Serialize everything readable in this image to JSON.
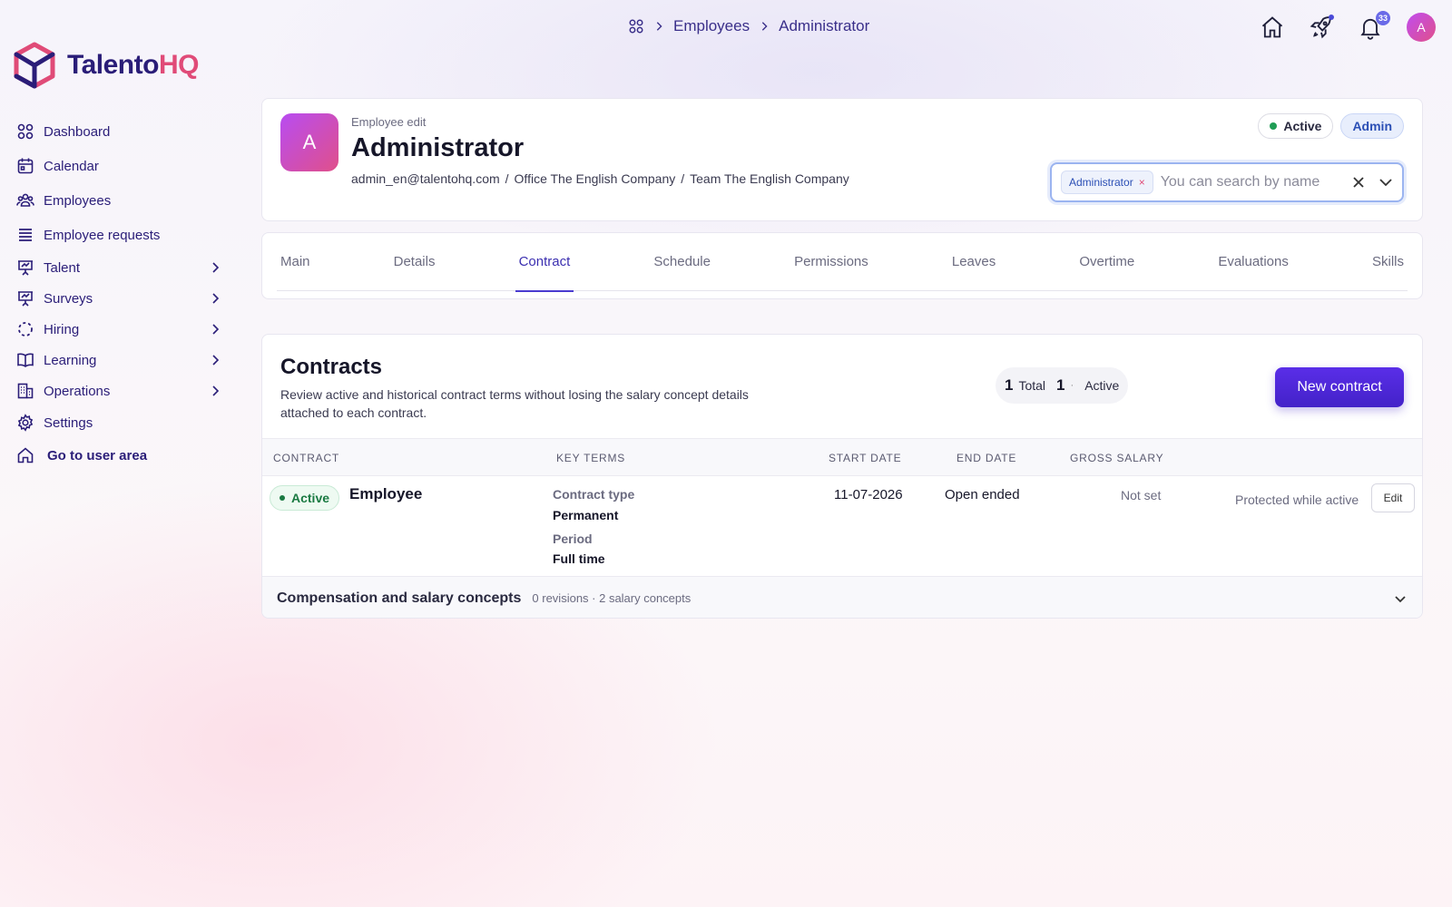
{
  "brand": {
    "part1": "Talento",
    "part2": "HQ"
  },
  "sidebar": {
    "items": [
      {
        "label": "Dashboard",
        "icon": "grid-icon"
      },
      {
        "label": "Calendar",
        "icon": "calendar-icon"
      },
      {
        "label": "Employees",
        "icon": "users-icon"
      },
      {
        "label": "Employee requests",
        "icon": "list-icon"
      },
      {
        "label": "Talent",
        "icon": "presentation-icon"
      },
      {
        "label": "Surveys",
        "icon": "presentation-icon"
      },
      {
        "label": "Hiring",
        "icon": "dashed-circle-icon"
      },
      {
        "label": "Learning",
        "icon": "book-icon"
      },
      {
        "label": "Operations",
        "icon": "building-icon"
      },
      {
        "label": "Settings",
        "icon": "gear-icon"
      },
      {
        "label": "Go to user area",
        "icon": "home-icon"
      }
    ]
  },
  "breadcrumb": {
    "items": [
      "Employees",
      "Administrator"
    ]
  },
  "topbar": {
    "notifications_count": "33"
  },
  "user": {
    "initial": "A"
  },
  "employee": {
    "subtitle": "Employee edit",
    "name": "Administrator",
    "initial": "A",
    "email": "admin_en@talentohq.com",
    "office": "Office The English Company",
    "team": "Team The English Company",
    "separator": "/",
    "status": "Active",
    "role": "Admin"
  },
  "search": {
    "chip": "Administrator",
    "placeholder": "You can search by name"
  },
  "tabs": [
    "Main",
    "Details",
    "Contract",
    "Schedule",
    "Permissions",
    "Leaves",
    "Overtime",
    "Evaluations",
    "Skills"
  ],
  "active_tab": "Contract",
  "contracts": {
    "title": "Contracts",
    "description": "Review active and historical contract terms without losing the salary concept details attached to each contract.",
    "stats": {
      "total_count": "1",
      "total_label": "Total",
      "active_count": "1",
      "active_label": "Active"
    },
    "new_button": "New contract",
    "columns": [
      "CONTRACT",
      "KEY TERMS",
      "START DATE",
      "END DATE",
      "GROSS SALARY"
    ],
    "rows": [
      {
        "status": "Active",
        "name": "Employee",
        "contract_type_label": "Contract type",
        "contract_type": "Permanent",
        "period_label": "Period",
        "period": "Full time",
        "start_date": "11-07-2026",
        "end_date": "Open ended",
        "gross_salary": "Not set",
        "note": "Protected while active",
        "edit_label": "Edit"
      }
    ],
    "compensation": {
      "title": "Compensation and salary concepts",
      "summary": "0 revisions · 2 salary concepts"
    }
  },
  "colors": {
    "brand_dark": "#2a1d78",
    "brand_pink": "#e04b78",
    "primary": "#4a2ed8",
    "active_green": "#1f9d55"
  }
}
